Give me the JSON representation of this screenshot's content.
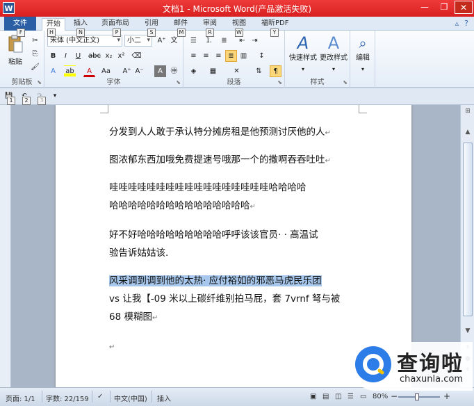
{
  "window": {
    "title": "文档1 - Microsoft Word(产品激活失败)",
    "app_icon": "W",
    "minimize": "—",
    "restore": "❐",
    "close": "✕"
  },
  "tabs": [
    {
      "label": "文件",
      "keytip": "F"
    },
    {
      "label": "开始",
      "keytip": "H"
    },
    {
      "label": "插入",
      "keytip": "N"
    },
    {
      "label": "页面布局",
      "keytip": "P"
    },
    {
      "label": "引用",
      "keytip": "S"
    },
    {
      "label": "邮件",
      "keytip": "M"
    },
    {
      "label": "审阅",
      "keytip": "R"
    },
    {
      "label": "视图",
      "keytip": "W"
    },
    {
      "label": "福昕PDF",
      "keytip": "Y"
    }
  ],
  "ribbon": {
    "clipboard": {
      "label": "剪贴板",
      "paste": "粘贴"
    },
    "font": {
      "label": "字体",
      "font_name": "宋体 (中文正文)",
      "font_size": "小二"
    },
    "paragraph": {
      "label": "段落"
    },
    "styles": {
      "label": "样式",
      "quick_styles": "快速样式",
      "change_styles": "更改样式"
    },
    "editing": {
      "label": "编辑",
      "find": "编辑"
    }
  },
  "document": {
    "paragraphs": [
      {
        "lines": [
          "分发到人人敢于承认特分摊房租是他预测讨厌他的人"
        ]
      },
      {
        "lines": [
          "图浓郁东西加哦免费提速号哦那一个的撒啊吞吞吐吐"
        ]
      },
      {
        "lines": [
          "哇哇哇哇哇哇哇哇哇哇哇哇哇哇哇哇哇哈哈哈哈",
          "哈哈哈哈哈哈哈哈哈哈哈哈哈哈哈"
        ]
      },
      {
        "lines": [
          "好不好哈哈哈哈哈哈哈哈哈呼呼该该官员· · 高温试",
          "验告诉姑姑该."
        ]
      },
      {
        "lines": [
          "风采调到调到他的太热· 应付裕如的邪恶马虎民乐团",
          "vs 让我【-09 米以上碳纤维别拍马屁，套 7vrnf 弩与被",
          "68 模糊图"
        ]
      }
    ],
    "pilcrow": "↵"
  },
  "statusbar": {
    "page": "页面: 1/1",
    "words": "字数: 22/159",
    "language": "中文(中国)",
    "mode": "插入",
    "zoom": "80%",
    "zoom_minus": "−",
    "zoom_plus": "+"
  },
  "watermark": {
    "brand_cn": "查询啦",
    "brand_en": "chaxunla.com"
  }
}
